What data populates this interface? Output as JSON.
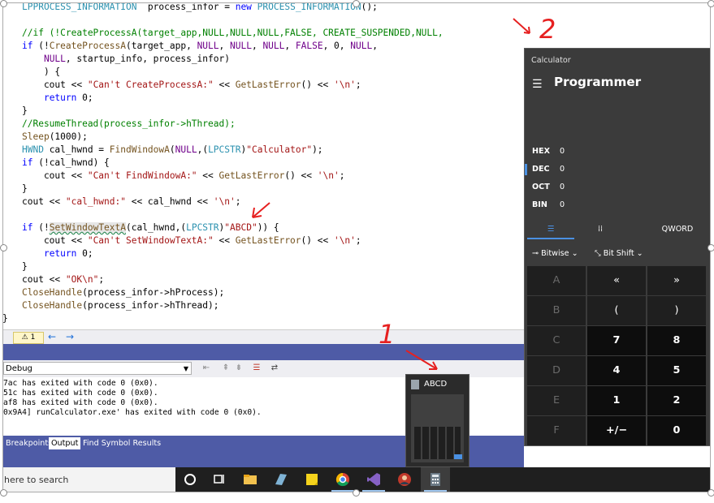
{
  "code": {
    "lines": [
      {
        "text": "LPPROCESS_INFORMATION  process_infor = new PROCESS_INFORMATION();"
      },
      {
        "text": ""
      },
      {
        "text": "//if (!CreateProcessA(target_app,NULL,NULL,NULL,FALSE, CREATE_SUSPENDED,NULL,"
      },
      {
        "text": "if (!CreateProcessA(target_app, NULL, NULL, NULL, FALSE, 0, NULL,"
      },
      {
        "text": "    NULL, startup_info, process_infor)"
      },
      {
        "text": "    ) {"
      },
      {
        "text": "    cout << \"Can't CreateProcessA:\" << GetLastError() << '\\n';"
      },
      {
        "text": "    return 0;"
      },
      {
        "text": "}"
      },
      {
        "text": "//ResumeThread(process_infor->hThread);"
      },
      {
        "text": "Sleep(1000);"
      },
      {
        "text": "HWND cal_hwnd = FindWindowA(NULL,(LPCSTR)\"Calculator\");"
      },
      {
        "text": "if (!cal_hwnd) {"
      },
      {
        "text": "    cout << \"Can't FindWindowA:\" << GetLastError() << '\\n';"
      },
      {
        "text": "}"
      },
      {
        "text": "cout << \"cal_hwnd:\" << cal_hwnd << '\\n';"
      },
      {
        "text": ""
      },
      {
        "text": "if (!SetWindowTextA(cal_hwnd,(LPCSTR)\"ABCD\")) {"
      },
      {
        "text": "    cout << \"Can't SetWindowTextA:\" << GetLastError() << '\\n';"
      },
      {
        "text": "    return 0;"
      },
      {
        "text": "}"
      },
      {
        "text": "cout << \"OK\\n\";"
      },
      {
        "text": "CloseHandle(process_infor->hProcess);"
      },
      {
        "text": "CloseHandle(process_infor->hThread);"
      }
    ],
    "closing_brace": "}"
  },
  "editor_status": {
    "warning_count": "⚠ 1",
    "nav_back": "←",
    "nav_forward": "→"
  },
  "output": {
    "source_select": "Debug",
    "lines": [
      "7ac has exited with code 0 (0x0).",
      "51c has exited with code 0 (0x0).",
      "af8 has exited with code 0 (0x0).",
      "0x9A4] runCalculator.exe' has exited with code 0 (0x0)."
    ]
  },
  "bottom_tabs": [
    {
      "label": "Breakpoints",
      "active": false
    },
    {
      "label": "Output",
      "active": true
    },
    {
      "label": "Find Symbol Results",
      "active": false
    }
  ],
  "taskbar": {
    "search_text": "here to search"
  },
  "thumbnail": {
    "title": "ABCD"
  },
  "calculator": {
    "window_title": "Calculator",
    "mode": "Programmer",
    "radix": [
      {
        "name": "HEX",
        "value": "0"
      },
      {
        "name": "DEC",
        "value": "0"
      },
      {
        "name": "OCT",
        "value": "0"
      },
      {
        "name": "BIN",
        "value": "0"
      }
    ],
    "word_size": "QWORD",
    "bitwise_label": "Bitwise",
    "bitshift_label": "Bit Shift",
    "keys": [
      [
        "A",
        "«",
        "»"
      ],
      [
        "B",
        "(",
        ")"
      ],
      [
        "C",
        "7",
        "8"
      ],
      [
        "D",
        "4",
        "5"
      ],
      [
        "E",
        "1",
        "2"
      ],
      [
        "F",
        "+/−",
        "0"
      ]
    ]
  },
  "annotations": {
    "label_1": "1",
    "label_2": "2"
  },
  "colors": {
    "accent": "#4a90e2",
    "annotation": "#e62020",
    "vs_blue": "#4e5ba6"
  }
}
